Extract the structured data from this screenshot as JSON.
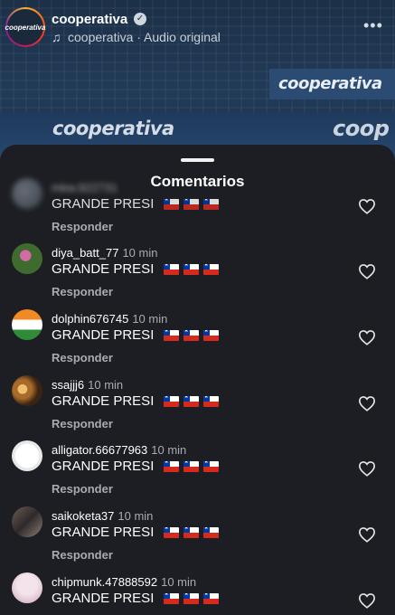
{
  "header": {
    "account_name": "cooperativa",
    "audio_text": "cooperativa · Audio original",
    "avatar_text": "cooperativa",
    "more_label": "•••"
  },
  "background": {
    "logo_right": "cooperativa",
    "logo_mid": "cooperativa",
    "logo_far": "coop"
  },
  "sheet": {
    "title": "Comentarios"
  },
  "comments": [
    {
      "user": "",
      "time": "",
      "text": "GRANDE PRESI",
      "reply": "Responder",
      "avatar": "blurred"
    },
    {
      "user": "diya_batt_77",
      "time": "10 min",
      "text": "GRANDE PRESI",
      "reply": "Responder",
      "avatar": "flower"
    },
    {
      "user": "dolphin676745",
      "time": "10 min",
      "text": "GRANDE PRESI",
      "reply": "Responder",
      "avatar": "india-flag"
    },
    {
      "user": "ssajjj6",
      "time": "10 min",
      "text": "GRANDE PRESI",
      "reply": "Responder",
      "avatar": "food"
    },
    {
      "user": "alligator.66677963",
      "time": "10 min",
      "text": "GRANDE PRESI",
      "reply": "Responder",
      "avatar": "logo"
    },
    {
      "user": "saikoketa37",
      "time": "10 min",
      "text": "GRANDE PRESI",
      "reply": "Responder",
      "avatar": "photo"
    },
    {
      "user": "chipmunk.47888592",
      "time": "10 min",
      "text": "GRANDE PRESI",
      "reply": "Responder",
      "avatar": "photo"
    }
  ],
  "icons": {
    "flag": "chile-flag-icon",
    "like": "heart-outline-icon",
    "verified": "verified-badge-icon",
    "music": "music-note-icon"
  }
}
